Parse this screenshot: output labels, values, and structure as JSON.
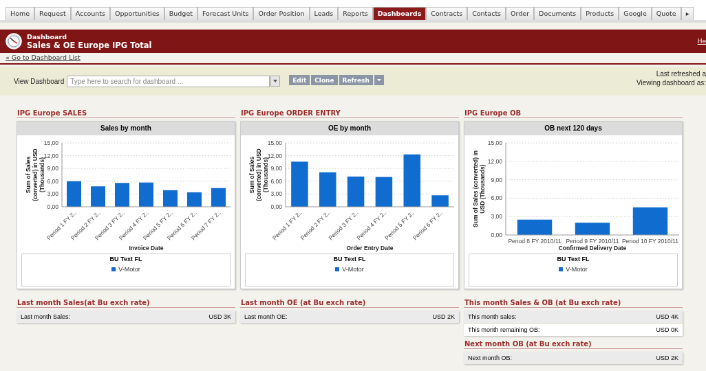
{
  "tabs": [
    {
      "label": "Home",
      "selected": false
    },
    {
      "label": "Request",
      "selected": false
    },
    {
      "label": "Accounts",
      "selected": false
    },
    {
      "label": "Opportunities",
      "selected": false
    },
    {
      "label": "Budget",
      "selected": false
    },
    {
      "label": "Forecast Units",
      "selected": false
    },
    {
      "label": "Order Position",
      "selected": false
    },
    {
      "label": "Leads",
      "selected": false
    },
    {
      "label": "Reports",
      "selected": false
    },
    {
      "label": "Dashboards",
      "selected": true
    },
    {
      "label": "Contracts",
      "selected": false
    },
    {
      "label": "Contacts",
      "selected": false
    },
    {
      "label": "Order",
      "selected": false
    },
    {
      "label": "Documents",
      "selected": false
    },
    {
      "label": "Products",
      "selected": false
    },
    {
      "label": "Google",
      "selected": false
    },
    {
      "label": "Quote",
      "selected": false
    },
    {
      "label": "▸",
      "selected": false
    }
  ],
  "header": {
    "label": "Dashboard",
    "title": "Sales & OE Europe IPG Total",
    "help": "He"
  },
  "back_link": "« Go to Dashboard List",
  "toolbar": {
    "label": "View Dashboard",
    "search": {
      "placeholder": "Type here to search for dashboard ..."
    },
    "buttons": [
      "Edit",
      "Clone",
      "Refresh"
    ],
    "last_refreshed": "Last refreshed a",
    "viewing_as": "Viewing dashboard as:"
  },
  "panels": [
    {
      "title": "IPG Europe SALES",
      "widget": {
        "header": "Sales by month",
        "chart_data": {
          "type": "bar",
          "xlabel": "Invoice Date",
          "ylabel": "Sum of Sales (converted) in USD (Thousands)",
          "categories": [
            "Period 1 FY 2..",
            "Period 2 FY 2..",
            "Period 3 FY 2..",
            "Period 4 FY 2..",
            "Period 5 FY 2..",
            "Period 6 FY 2..",
            "Period 7 FY 2.."
          ],
          "series": [
            {
              "name": "V-Motor",
              "color": "#106ccf",
              "values": [
                6.0,
                4.8,
                5.6,
                5.7,
                3.9,
                3.4,
                4.4
              ]
            }
          ],
          "grid": true,
          "ylim": [
            0,
            15
          ],
          "yticks": [
            {
              "value": 0,
              "label": "0,00"
            },
            {
              "value": 3,
              "label": "3,00"
            },
            {
              "value": 6,
              "label": "6,00"
            },
            {
              "value": 9,
              "label": "9,00"
            },
            {
              "value": 12,
              "label": "12,00"
            },
            {
              "value": 15,
              "label": "15,00"
            }
          ]
        },
        "legend": {
          "title": "BU Text FL"
        }
      }
    },
    {
      "title": "IPG Europe ORDER ENTRY",
      "widget": {
        "header": "OE by month",
        "chart_data": {
          "type": "bar",
          "xlabel": "Order Entry Date",
          "ylabel": "Sum of Sales (converted) in USD (Thousands)",
          "categories": [
            "Period 1 FY 2..",
            "Period 2 FY 2..",
            "Period 3 FY 2..",
            "Period 4 FY 2..",
            "Period 5 FY 2..",
            "Period 6 FY 2.."
          ],
          "series": [
            {
              "name": "V-Motor",
              "color": "#106ccf",
              "values": [
                10.6,
                8.1,
                7.1,
                7.0,
                12.3,
                2.7
              ]
            }
          ],
          "grid": true,
          "ylim": [
            0,
            15
          ],
          "yticks": [
            {
              "value": 0,
              "label": "0,00"
            },
            {
              "value": 3,
              "label": "3,00"
            },
            {
              "value": 6,
              "label": "6,00"
            },
            {
              "value": 9,
              "label": "9,00"
            },
            {
              "value": 12,
              "label": "12,00"
            },
            {
              "value": 15,
              "label": "15,00"
            }
          ]
        },
        "legend": {
          "title": "BU Text FL"
        }
      }
    },
    {
      "title": "IPG Europe OB",
      "widget": {
        "header": "OB next 120 days",
        "chart_data": {
          "type": "bar",
          "xlabel": "Confirmed Delivery Date",
          "ylabel": "Sum of Sales (converted) in USD (Thousands)",
          "categories": [
            "Period 8 FY 2010/11",
            "Period 9 FY 2010/11",
            "Period 10 FY 2010/11"
          ],
          "series": [
            {
              "name": "V-Motor",
              "color": "#106ccf",
              "values": [
                2.5,
                2.0,
                4.5
              ]
            }
          ],
          "grid": true,
          "ylim": [
            0,
            15
          ],
          "yticks": [
            {
              "value": 0,
              "label": "0,00"
            },
            {
              "value": 3,
              "label": "3,00"
            },
            {
              "value": 6,
              "label": "6,00"
            },
            {
              "value": 9,
              "label": "9,00"
            },
            {
              "value": 12,
              "label": "12,00"
            },
            {
              "value": 15,
              "label": "15,00"
            }
          ]
        },
        "legend": {
          "title": "BU Text FL"
        }
      }
    }
  ],
  "summaries": [
    [
      {
        "title": "Last month Sales(at Bu exch rate)",
        "rows": [
          {
            "label": "Last month Sales:",
            "value": "USD 3K"
          }
        ]
      }
    ],
    [
      {
        "title": "Last month OE (at Bu exch rate)",
        "rows": [
          {
            "label": "Last month OE:",
            "value": "USD 2K"
          }
        ]
      }
    ],
    [
      {
        "title": "This month Sales & OB (at Bu exch rate)",
        "rows": [
          {
            "label": "This month sales:",
            "value": "USD 4K"
          },
          {
            "label": "This month remaining OB:",
            "value": "USD 0K"
          }
        ]
      },
      {
        "title": "Next month OB (at Bu exch rate)",
        "rows": [
          {
            "label": "Next month OB:",
            "value": "USD 2K"
          }
        ]
      }
    ]
  ]
}
